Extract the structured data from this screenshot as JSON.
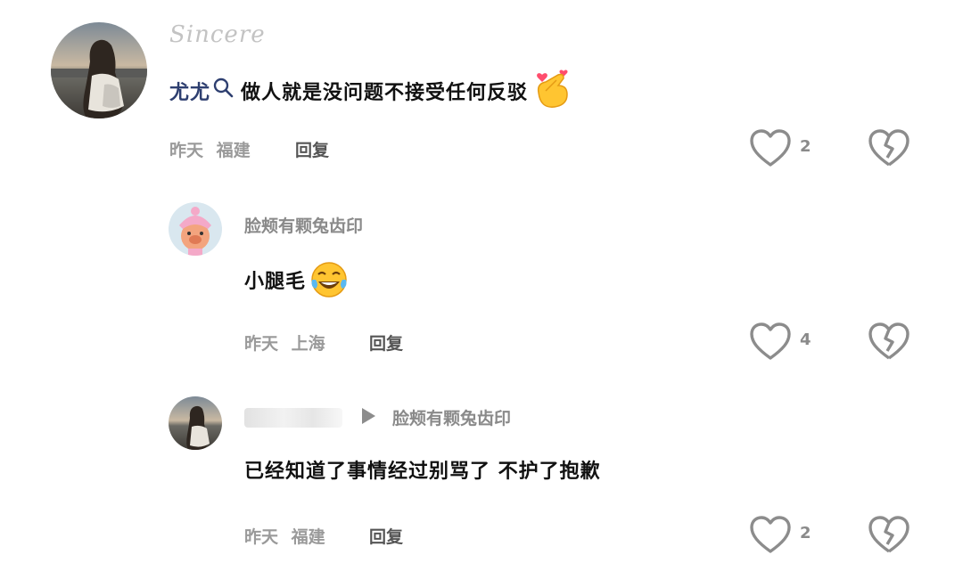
{
  "comments": [
    {
      "username": "Sincere",
      "mention": "尤尤",
      "text": "做人就是没问题不接受任何反驳",
      "emoji": "finger-heart",
      "time": "昨天",
      "location": "福建",
      "reply_label": "回复",
      "like_count": "2"
    },
    {
      "username": "脸颊有颗兔齿印",
      "text": "小腿毛",
      "emoji": "tears-of-joy",
      "time": "昨天",
      "location": "上海",
      "reply_label": "回复",
      "like_count": "4"
    },
    {
      "username": "",
      "reply_to": "脸颊有颗兔齿印",
      "text": "已经知道了事情经过别骂了 不护了抱歉",
      "time": "昨天",
      "location": "福建",
      "reply_label": "回复",
      "like_count": "2"
    }
  ],
  "colors": {
    "text": "#111111",
    "meta": "#9a9a9a",
    "mention": "#2e3f70",
    "icon": "#8c8c8c"
  }
}
